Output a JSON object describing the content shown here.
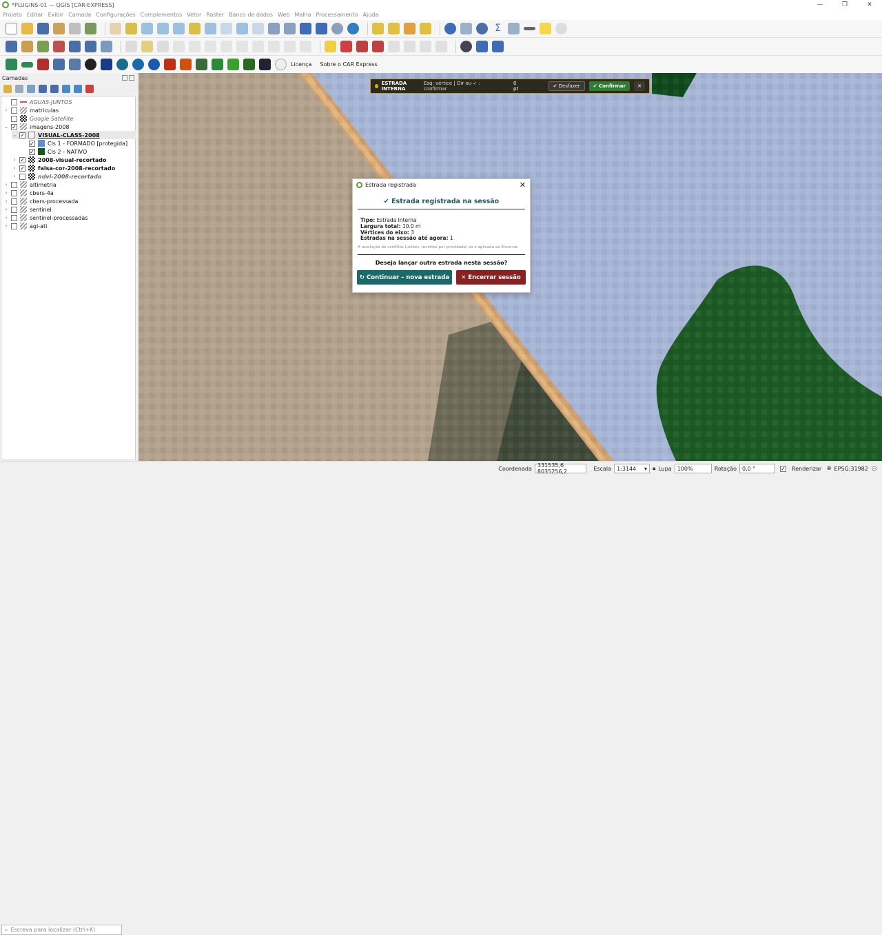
{
  "window": {
    "title": "*PLUGINS-01 — QGIS [CAR-EXPRESS]",
    "min": "—",
    "max": "❐",
    "close": "✕"
  },
  "menu": [
    "Projeto",
    "Editar",
    "Exibir",
    "Camada",
    "Configurações",
    "Complementos",
    "Vetor",
    "Raster",
    "Banco de dados",
    "Web",
    "Malha",
    "Processamento",
    "Ajuda"
  ],
  "toolbar3": {
    "license_label": "Licença",
    "about_label": "Sobre o CAR Express"
  },
  "layers_panel": {
    "title": "Camadas",
    "items": [
      {
        "label": "AGUAS-JUNTOS",
        "checked": false,
        "style": "italic"
      },
      {
        "label": "matriculas",
        "checked": false
      },
      {
        "label": "Google Satellite",
        "checked": false,
        "style": "italic"
      },
      {
        "label": "imagens-2008",
        "checked": true
      },
      {
        "label": "VISUAL-CLASS-2008",
        "checked": true,
        "style": "bold"
      },
      {
        "label": "Cls 1 - FORMADO [protegida]",
        "checked": true,
        "color": "#5b8fd9"
      },
      {
        "label": "Cls 2 - NATIVO",
        "checked": true,
        "color": "#0b5a1e"
      },
      {
        "label": "2008-visual-recortado",
        "checked": true,
        "style": "bold"
      },
      {
        "label": "falsa-cor-2008-recortado",
        "checked": true,
        "style": "bold"
      },
      {
        "label": "ndvi-2008-recortado",
        "checked": false,
        "style": "italic"
      },
      {
        "label": "altimetria",
        "checked": false
      },
      {
        "label": "cbers-4a",
        "checked": false
      },
      {
        "label": "cbers-processada",
        "checked": false
      },
      {
        "label": "sentinel",
        "checked": false
      },
      {
        "label": "sentinel-processadas",
        "checked": false
      },
      {
        "label": "agi-ati",
        "checked": false
      }
    ]
  },
  "locator": {
    "placeholder": "Escreva para localizar (Ctrl+K)"
  },
  "snap_bar": {
    "title": "ESTRADA INTERNA",
    "hint": "Esq: vértice  |  Dir ou ✓ : confirmar",
    "points": "0 pt",
    "undo_label": "Desfazer",
    "confirm_label": "Confirmar",
    "close": "✕"
  },
  "dialog": {
    "title": "Estrada registrada",
    "heading": "✔ Estrada registrada na sessão",
    "info": [
      {
        "k": "Tipo:",
        "v": "Estrada Interna"
      },
      {
        "k": "Largura total:",
        "v": "10.0 m"
      },
      {
        "k": "Vértices do eixo:",
        "v": "3"
      },
      {
        "k": "Estradas na sessão até agora:",
        "v": "1"
      }
    ],
    "note": "A resolução de conflitos (uniões, recortes por prioridade) só é aplicada ao Encerrar.",
    "question": "Deseja lançar outra estrada nesta sessão?",
    "continue_label": "↻  Continuar – nova estrada",
    "end_label": "✕  Encerrar sessão",
    "close": "✕"
  },
  "status": {
    "coord_label": "Coordenada",
    "coord_value": "331535,6  8035256,2",
    "scale_label": "Escala",
    "scale_value": "1:3144",
    "magnifier_label": "Lupa",
    "magnifier_value": "100%",
    "rotation_label": "Rotação",
    "rotation_value": "0,0 °",
    "render_label": "Renderizar",
    "epsg": "EPSG:31982"
  },
  "colors": {
    "accent_teal": "#1b6a6a",
    "danger": "#8b2020",
    "confirm": "#2e7d32",
    "nativo": "#0b5a1e",
    "formado": "#5b8fd9"
  }
}
